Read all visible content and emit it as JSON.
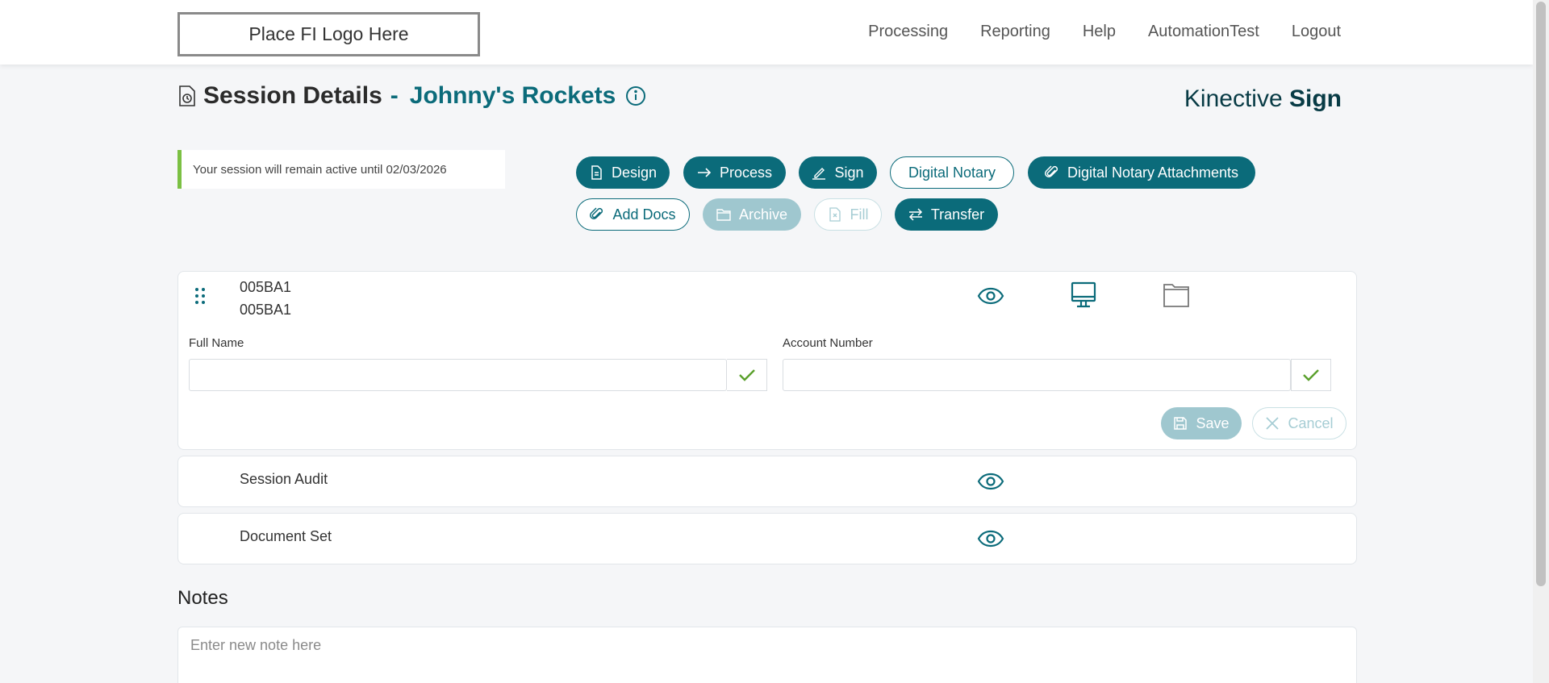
{
  "header": {
    "logo_text": "Place FI Logo Here",
    "nav": [
      "Processing",
      "Reporting",
      "Help",
      "AutomationTest",
      "Logout"
    ]
  },
  "page": {
    "title": "Session Details",
    "separator": "-",
    "client_name": "Johnny's Rockets",
    "brand_light": "Kinective",
    "brand_bold": "Sign"
  },
  "session_notice": "Your session will remain active until 02/03/2026",
  "actions": {
    "design": "Design",
    "process": "Process",
    "sign": "Sign",
    "digital_notary": "Digital Notary",
    "digital_notary_attachments": "Digital Notary Attachments",
    "add_docs": "Add Docs",
    "archive": "Archive",
    "fill": "Fill",
    "transfer": "Transfer"
  },
  "document": {
    "id_line1": "005BA1",
    "id_line2": "005BA1",
    "fields": [
      {
        "label": "Full Name",
        "value": ""
      },
      {
        "label": "Account Number",
        "value": ""
      }
    ],
    "save_label": "Save",
    "cancel_label": "Cancel"
  },
  "rows": [
    {
      "label": "Session Audit"
    },
    {
      "label": "Document Set"
    }
  ],
  "notes": {
    "title": "Notes",
    "placeholder": "Enter new note here"
  },
  "colors": {
    "primary": "#0b6b7a",
    "accent_green": "#7bc043",
    "disabled": "#9fc7cf"
  }
}
